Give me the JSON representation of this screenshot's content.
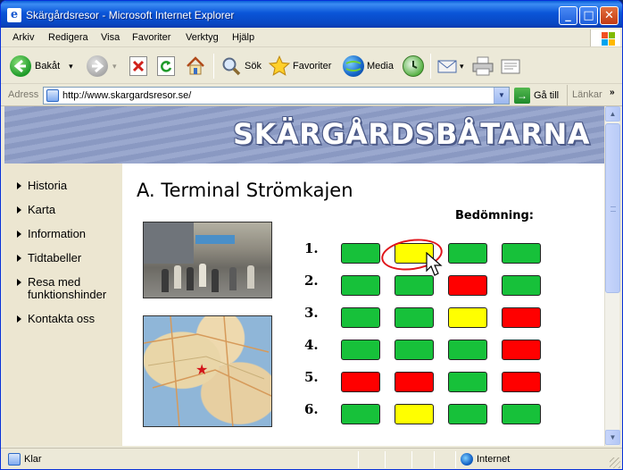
{
  "window": {
    "title": "Skärgårdsresor - Microsoft Internet Explorer",
    "app_icon": "e-icon",
    "controls": {
      "minimize": "_",
      "maximize": "□",
      "close": "✕"
    }
  },
  "menubar": {
    "items": [
      "Arkiv",
      "Redigera",
      "Visa",
      "Favoriter",
      "Verktyg",
      "Hjälp"
    ]
  },
  "toolbar": {
    "back_label": "Bakåt",
    "search_label": "Sök",
    "favorites_label": "Favoriter",
    "media_label": "Media",
    "dropdown_glyph": "▾"
  },
  "addressbar": {
    "label": "Adress",
    "url": "http://www.skargardsresor.se/",
    "go_label": "Gå till",
    "go_glyph": "→",
    "links_label": "Länkar",
    "links_chevron": "»",
    "drop_glyph": "▼"
  },
  "site": {
    "banner_title": "SKÄRGÅRDSBÅTARNA",
    "nav": [
      {
        "label": "Historia"
      },
      {
        "label": "Karta"
      },
      {
        "label": "Information"
      },
      {
        "label": "Tidtabeller"
      },
      {
        "label": "Resa med funktionshinder"
      },
      {
        "label": "Kontakta oss"
      }
    ],
    "page_title": "A. Terminal Strömkajen",
    "rating_header": "Bedömning:",
    "colors": {
      "green": "#17c13a",
      "yellow": "#ffff00",
      "red": "#ff0000"
    },
    "ratings": [
      {
        "label": "1.",
        "cells": [
          "green",
          "yellow",
          "green",
          "green"
        ]
      },
      {
        "label": "2.",
        "cells": [
          "green",
          "green",
          "red",
          "green"
        ]
      },
      {
        "label": "3.",
        "cells": [
          "green",
          "green",
          "yellow",
          "red"
        ]
      },
      {
        "label": "4.",
        "cells": [
          "green",
          "green",
          "green",
          "red"
        ]
      },
      {
        "label": "5.",
        "cells": [
          "red",
          "red",
          "green",
          "red"
        ]
      },
      {
        "label": "6.",
        "cells": [
          "green",
          "yellow",
          "green",
          "green"
        ]
      }
    ],
    "highlighted": {
      "row": 1,
      "column": 2
    }
  },
  "scrollbar": {
    "up_glyph": "▲",
    "down_glyph": "▼"
  },
  "statusbar": {
    "text": "Klar",
    "zone": "Internet"
  }
}
